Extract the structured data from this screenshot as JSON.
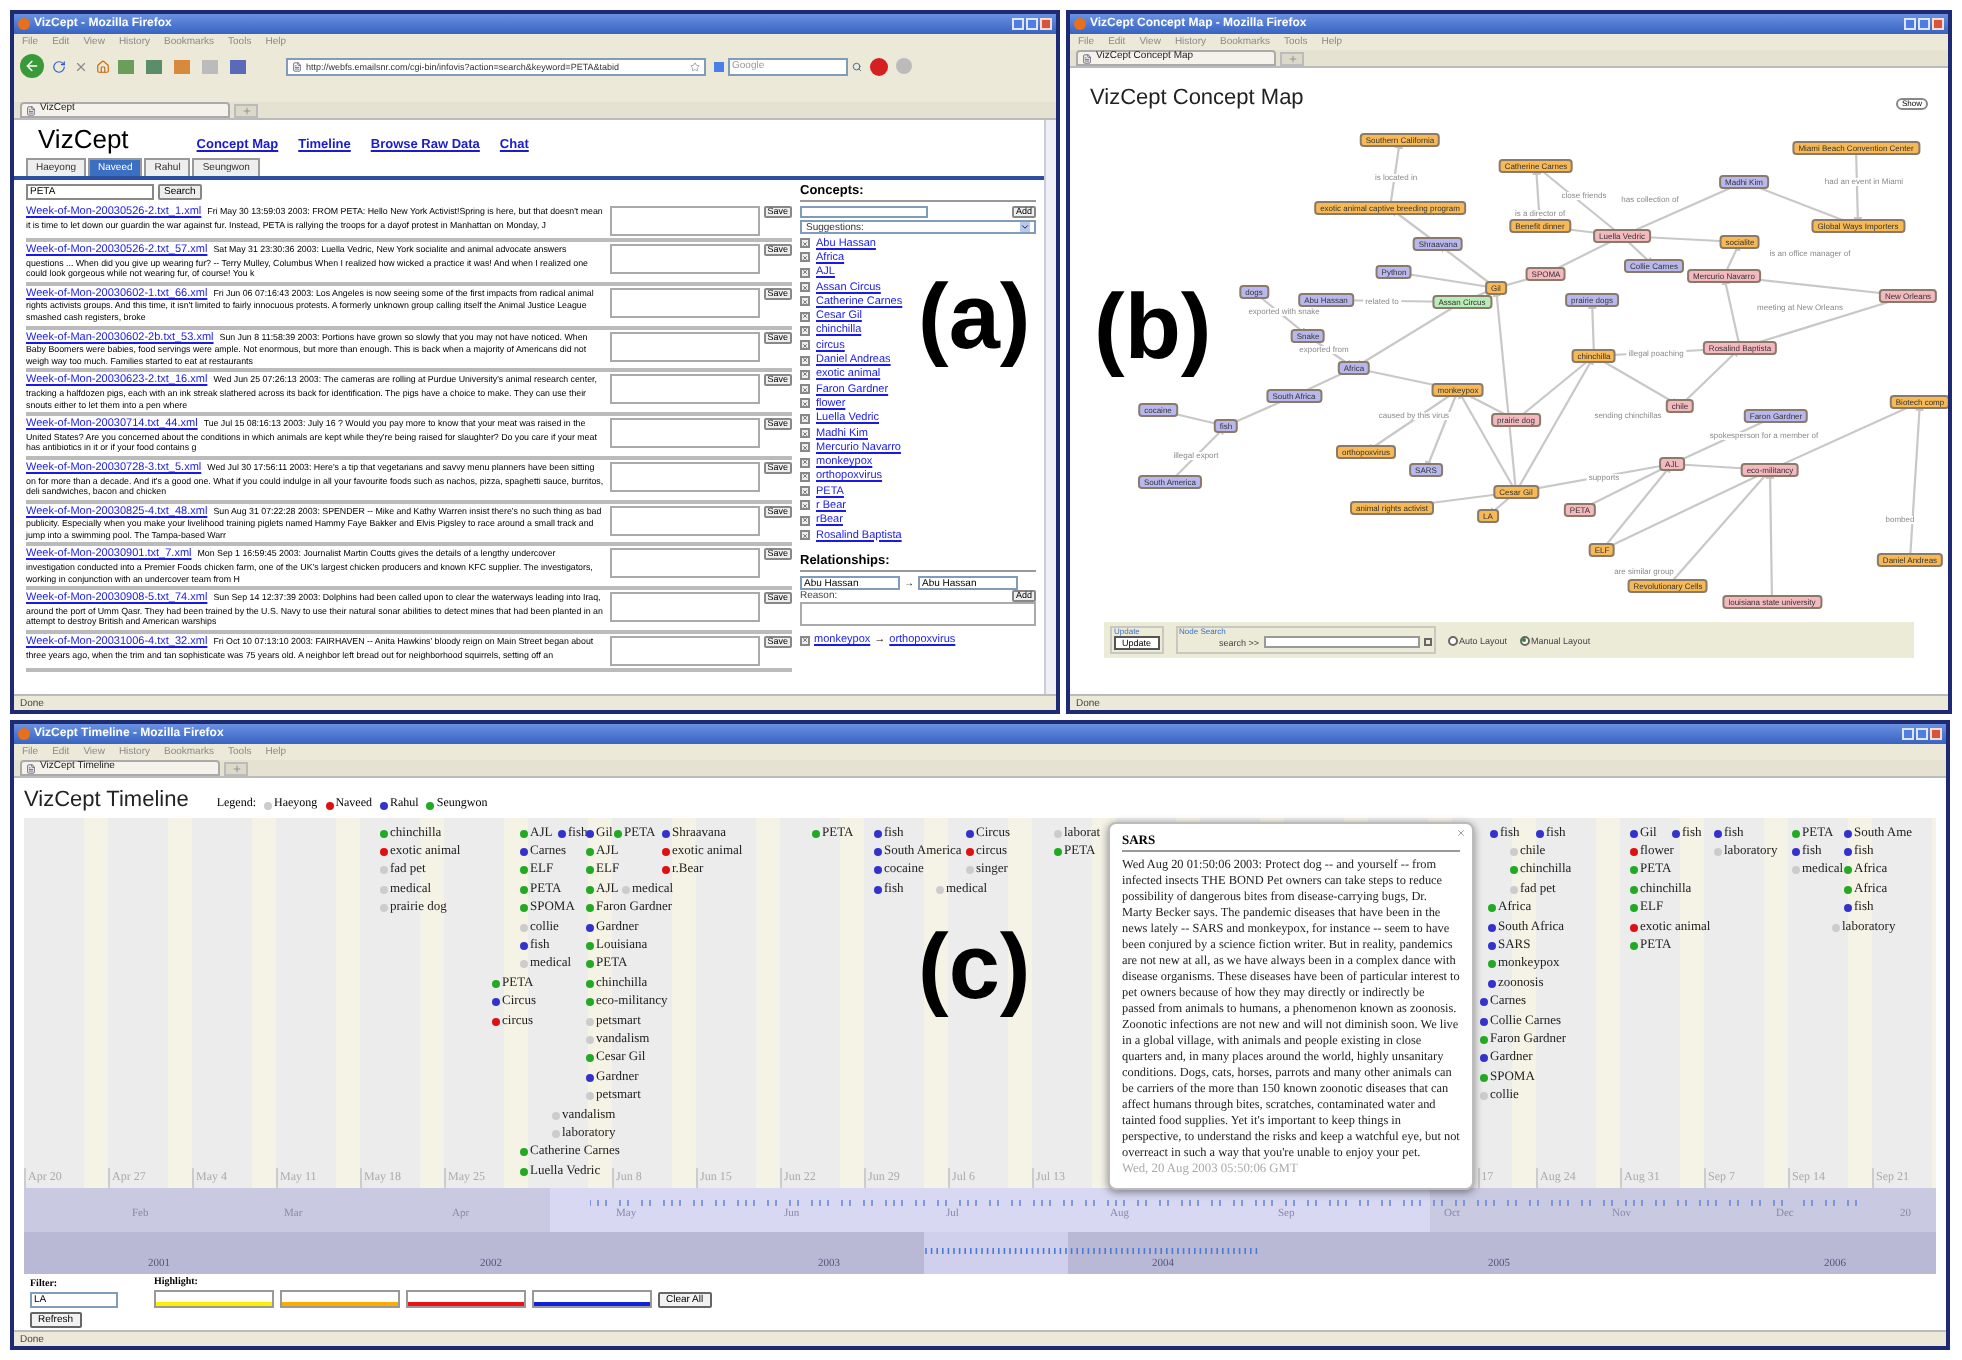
{
  "window_a": {
    "title": "VizCept - Mozilla Firefox",
    "menu": [
      "File",
      "Edit",
      "View",
      "History",
      "Bookmarks",
      "Tools",
      "Help"
    ],
    "url": "http://webfs.emailsnr.com/cgi-bin/infovis?action=search&keyword=PETA&tabid",
    "search_placeholder": "Google",
    "tab": "VizCept",
    "app_title": "VizCept",
    "nav_links": [
      "Concept Map",
      "Timeline",
      "Browse Raw Data",
      "Chat"
    ],
    "user_tabs": [
      {
        "label": "Haeyong",
        "selected": false
      },
      {
        "label": "Naveed",
        "selected": true
      },
      {
        "label": "Rahul",
        "selected": false
      },
      {
        "label": "Seungwon",
        "selected": false
      }
    ],
    "search": {
      "value": "PETA",
      "button": "Search"
    },
    "results": [
      {
        "link": "Week-of-Mon-20030526-2.txt_1.xml",
        "text": "Fri May 30 13:59:03 2003: FROM PETA: Hello New York Activist!Spring is here, but that doesn't mean it is time to let down our guardin the war against fur. Instead, PETA is rallying the troops for a dayof protest in Manhattan on Monday, J",
        "button": "Save"
      },
      {
        "link": "Week-of-Mon-20030526-2.txt_57.xml",
        "text": "Sat May 31 23:30:36 2003: Luella Vedric, New York socialite and animal advocate answers questions ... When did you give up wearing fur? -- Terry Mulley, Columbus When I realized how wicked a practice it was! And when I realized one could look gorgeous while not wearing fur, of course! You k",
        "button": "Save"
      },
      {
        "link": "Week-of-Mon-20030602-1.txt_66.xml",
        "text": "Fri Jun 06 07:16:43 2003: Los Angeles is now seeing some of the first impacts from radical animal rights activists groups. And this time, it isn't limited to fairly innocuous protests. A formerly unknown group calling itself the Animal Justice League smashed cash registers, broke",
        "button": "Save"
      },
      {
        "link": "Week-of-Man-20030602-2b.txt_53.xml",
        "text": "Sun Jun 8 11:58:39 2003: Portions have grown so slowly that you may not have noticed. When Baby Boomers were babies, food servings were ample. Not enormous, but more than enough. This is back when a majority of Americans did not weigh way too much. Families started to eat at restaurants",
        "button": "Save"
      },
      {
        "link": "Week-of-Mon-20030623-2.txt_16.xml",
        "text": "Wed Jun 25 07:26:13 2003: The cameras are rolling at Purdue University's animal research center, tracking a halfdozen pigs, each with an ink streak slathered across its back for identification. The pigs have a choice to make. They can use their snouts either to let them into a pen where",
        "button": "Save"
      },
      {
        "link": "Week-of-Mon-20030714.txt_44.xml",
        "text": "Tue Jul 15 08:16:13 2003: July 16 ? Would you pay more to know that your meat was raised in the United States? Are you concerned about the conditions in which animals are kept while they're being raised for slaughter? Do you care if your meat has antibiotics in it or if your food contains g",
        "button": "Save"
      },
      {
        "link": "Week-of-Mon-20030728-3.txt_5.xml",
        "text": "Wed Jul 30 17:56:11 2003: Here's a tip that vegetarians and savvy menu planners have been sitting on for more than a decade. And it's a good one. What if you could indulge in all your favourite foods such as nachos, pizza, spaghetti sauce, burritos, deli sandwiches, bacon and chicken",
        "button": "Save"
      },
      {
        "link": "Week-of-Mon-20030825-4.txt_48.xml",
        "text": "Sun Aug 31 07:22:28 2003: SPENDER -- Mike and Kathy Warren insist there's no such thing as bad publicity. Especially when you make your livelihood training piglets named Hammy Faye Bakker and Elvis Pigsley to race around a small track and jump into a swimming pool. The Tampa-based Warr",
        "button": "Save"
      },
      {
        "link": "Week-of-Mon-20030901.txt_7.xml",
        "text": "Mon Sep 1 16:59:45 2003: Journalist Martin Coutts gives the details of a lengthy undercover investigation conducted into a Premier Foods chicken farm, one of the UK's largest chicken producers and known KFC supplier. The investigators, working in conjunction with an undercover team from H",
        "button": "Save"
      },
      {
        "link": "Week-of-Mon-20030908-5.txt_74.xml",
        "text": "Sun Sep 14 12:37:39 2003: Dolphins had been called upon to clear the waterways leading into Iraq, around the port of Umm Qasr. They had been trained by the U.S. Navy to use their natural sonar abilities to detect mines that had been planted in an attempt to destroy British and American warships",
        "button": "Save"
      },
      {
        "link": "Week-of-Mon-20031006-4.txt_32.xml",
        "text": "Fri Oct 10 07:13:10 2003: FAIRHAVEN -- Anita Hawkins' bloody reign on Main Street began about three years ago, when the trim and tan sophisticate was 75 years old. A neighbor left bread out for neighborhood squirrels, setting off an",
        "button": "Save"
      }
    ],
    "concepts": {
      "heading": "Concepts:",
      "add_button": "Add",
      "suggestions": "Suggestions:",
      "items": [
        "Abu Hassan",
        "Africa",
        "AJL",
        "Assan Circus",
        "Catherine Carnes",
        "Cesar Gil",
        "chinchilla",
        "circus",
        "Daniel Andreas",
        "exotic animal",
        "Faron Gardner",
        "flower",
        "Luella Vedric",
        "Madhi Kim",
        "Mercurio Navarro",
        "monkeypox",
        "orthopoxvirus",
        "PETA",
        "r Bear",
        "rBear",
        "Rosalind Baptista"
      ]
    },
    "relationships": {
      "heading": "Relationships:",
      "from": "Abu Hassan",
      "arrow": "→",
      "to": "Abu Hassan",
      "reason_label": "Reason:",
      "add_button": "Add",
      "items": [
        {
          "from": "monkeypox",
          "arrow": "→",
          "to": "orthopoxvirus"
        }
      ]
    },
    "status": "Done",
    "panel_label": "(a)"
  },
  "window_b": {
    "title": "VizCept Concept Map - Mozilla Firefox",
    "menu": [
      "File",
      "Edit",
      "View",
      "History",
      "Bookmarks",
      "Tools",
      "Help"
    ],
    "tab": "VizCept Concept Map",
    "heading": "VizCept Concept Map",
    "show_button": "Show",
    "nodes": [
      {
        "label": "Southern California",
        "color": "#f7b955"
      },
      {
        "label": "exotic animal captive breeding program",
        "color": "#f7b955"
      },
      {
        "label": "Catherine Carnes",
        "color": "#f7b955"
      },
      {
        "label": "Miami Beach Convention Center",
        "color": "#f7b955"
      },
      {
        "label": "Madhi Kim",
        "color": "#b8b8ee"
      },
      {
        "label": "Benefit dinner",
        "color": "#f7b955"
      },
      {
        "label": "Global Ways Importers",
        "color": "#f7b955"
      },
      {
        "label": "Luella Vedric",
        "color": "#f4b8bf"
      },
      {
        "label": "socialite",
        "color": "#f7b955"
      },
      {
        "label": "Collie Carnes",
        "color": "#b8b8ee"
      },
      {
        "label": "Shraavana",
        "color": "#b8b8ee"
      },
      {
        "label": "Python",
        "color": "#b8b8ee"
      },
      {
        "label": "SPOMA",
        "color": "#f4b8bf"
      },
      {
        "label": "Mercurio Navarro",
        "color": "#f4b8bf"
      },
      {
        "label": "Gil",
        "color": "#f7b955"
      },
      {
        "label": "New Orleans",
        "color": "#f4b8bf"
      },
      {
        "label": "dogs",
        "color": "#b8b8ee"
      },
      {
        "label": "Abu Hassan",
        "color": "#b8b8ee"
      },
      {
        "label": "Assan Circus",
        "color": "#b8ecb8"
      },
      {
        "label": "prairie dogs",
        "color": "#b8b8ee"
      },
      {
        "label": "Snake",
        "color": "#b8b8ee"
      },
      {
        "label": "Rosalind Baptista",
        "color": "#f4b8bf"
      },
      {
        "label": "chinchilla",
        "color": "#f7b955"
      },
      {
        "label": "Africa",
        "color": "#b8b8ee"
      },
      {
        "label": "monkeypox",
        "color": "#f7b955"
      },
      {
        "label": "South Africa",
        "color": "#b8b8ee"
      },
      {
        "label": "chile",
        "color": "#f4b8bf"
      },
      {
        "label": "Biotech comp",
        "color": "#f7b955"
      },
      {
        "label": "cocaine",
        "color": "#b8b8ee"
      },
      {
        "label": "fish",
        "color": "#b8b8ee"
      },
      {
        "label": "prairie dog",
        "color": "#f4b8bf"
      },
      {
        "label": "Faron Gardner",
        "color": "#b8b8ee"
      },
      {
        "label": "orthopoxvirus",
        "color": "#f7b955"
      },
      {
        "label": "SARS",
        "color": "#b8b8ee"
      },
      {
        "label": "AJL",
        "color": "#f4b8bf"
      },
      {
        "label": "eco-militancy",
        "color": "#f4b8bf"
      },
      {
        "label": "South America",
        "color": "#b8b8ee"
      },
      {
        "label": "Cesar Gil",
        "color": "#f7b955"
      },
      {
        "label": "animal rights activist",
        "color": "#f7b955"
      },
      {
        "label": "PETA",
        "color": "#f4b8bf"
      },
      {
        "label": "LA",
        "color": "#f7b955"
      },
      {
        "label": "ELF",
        "color": "#f7b955"
      },
      {
        "label": "Revolutionary Cells",
        "color": "#f7b955"
      },
      {
        "label": "louisiana state university",
        "color": "#f4b8bf"
      },
      {
        "label": "Daniel Andreas",
        "color": "#f7b955"
      }
    ],
    "edge_labels": [
      "is located in",
      "close friends",
      "has collection of",
      "had an event in Miami",
      "is an office manager of",
      "is a director of",
      "related to",
      "exported with snake",
      "exported from",
      "illegal export",
      "meeting at New Orleans",
      "illegal poaching",
      "sending chinchillas",
      "spokesperson for a member of",
      "caused by this virus",
      "supports",
      "are similar group",
      "bombed"
    ],
    "update_legend": "Update",
    "update_button": "Update",
    "search_legend": "Node Search",
    "search_label": "search >>",
    "layouts": [
      {
        "label": "Auto Layout",
        "selected": false
      },
      {
        "label": "Manual Layout",
        "selected": true
      }
    ],
    "status": "Done",
    "panel_label": "(b)"
  },
  "window_c": {
    "title": "VizCept Timeline - Mozilla Firefox",
    "menu": [
      "File",
      "Edit",
      "View",
      "History",
      "Bookmarks",
      "Tools",
      "Help"
    ],
    "tab": "VizCept Timeline",
    "heading": "VizCept Timeline",
    "legend": {
      "label": "Legend:",
      "users": [
        {
          "name": "Haeyong",
          "color": "#cccccc"
        },
        {
          "name": "Naveed",
          "color": "#dd1111"
        },
        {
          "name": "Rahul",
          "color": "#3333cc"
        },
        {
          "name": "Seungwon",
          "color": "#22aa22"
        }
      ]
    },
    "columns": [
      {
        "items": [
          {
            "label": "chinchilla",
            "color": "#22aa22"
          },
          {
            "label": "exotic animal",
            "color": "#dd1111"
          },
          {
            "label": "fad pet",
            "color": "#cccccc"
          },
          {
            "label": "medical",
            "color": "#cccccc"
          },
          {
            "label": "prairie dog",
            "color": "#cccccc"
          }
        ]
      },
      {
        "items": [
          {
            "label": "AJL",
            "color": "#22aa22"
          },
          {
            "label": "Carnes",
            "color": "#3333cc"
          },
          {
            "label": "ELF",
            "color": "#22aa22"
          },
          {
            "label": "PETA",
            "color": "#22aa22"
          },
          {
            "label": "SPOMA",
            "color": "#22aa22"
          },
          {
            "label": "collie",
            "color": "#cccccc"
          },
          {
            "label": "fish",
            "color": "#3333cc"
          },
          {
            "label": "medical",
            "color": "#cccccc"
          }
        ]
      },
      {
        "items": [
          {
            "label": "PETA",
            "color": "#22aa22"
          },
          {
            "label": "Circus",
            "color": "#3333cc"
          },
          {
            "label": "circus",
            "color": "#dd1111"
          }
        ]
      },
      {
        "items": [
          {
            "label": "fish",
            "color": "#3333cc"
          }
        ]
      },
      {
        "items": [
          {
            "label": "Gil",
            "color": "#3333cc"
          },
          {
            "label": "AJL",
            "color": "#22aa22"
          },
          {
            "label": "ELF",
            "color": "#22aa22"
          },
          {
            "label": "AJL",
            "color": "#22aa22"
          },
          {
            "label": "Faron Gardner",
            "color": "#22aa22"
          },
          {
            "label": "Gardner",
            "color": "#3333cc"
          },
          {
            "label": "Louisiana",
            "color": "#22aa22"
          },
          {
            "label": "PETA",
            "color": "#22aa22"
          },
          {
            "label": "chinchilla",
            "color": "#22aa22"
          },
          {
            "label": "eco-militancy",
            "color": "#22aa22"
          },
          {
            "label": "petsmart",
            "color": "#cccccc"
          },
          {
            "label": "vandalism",
            "color": "#cccccc"
          },
          {
            "label": "Cesar Gil",
            "color": "#22aa22"
          },
          {
            "label": "Gardner",
            "color": "#3333cc"
          },
          {
            "label": "petsmart",
            "color": "#cccccc"
          }
        ]
      },
      {
        "items": [
          {
            "label": "PETA",
            "color": "#22aa22"
          }
        ]
      },
      {
        "items": [
          {
            "label": "medical",
            "color": "#cccccc"
          }
        ]
      },
      {
        "items": [
          {
            "label": "vandalism",
            "color": "#cccccc"
          },
          {
            "label": "laboratory",
            "color": "#cccccc"
          }
        ]
      },
      {
        "items": [
          {
            "label": "Catherine Carnes",
            "color": "#22aa22"
          },
          {
            "label": "Luella Vedric",
            "color": "#22aa22"
          }
        ]
      },
      {
        "items": [
          {
            "label": "Shraavana",
            "color": "#3333cc"
          },
          {
            "label": "exotic animal",
            "color": "#dd1111"
          },
          {
            "label": "r.Bear",
            "color": "#dd1111"
          }
        ]
      },
      {
        "items": [
          {
            "label": "PETA",
            "color": "#22aa22"
          }
        ]
      },
      {
        "items": [
          {
            "label": "fish",
            "color": "#3333cc"
          },
          {
            "label": "South America",
            "color": "#3333cc"
          },
          {
            "label": "cocaine",
            "color": "#3333cc"
          },
          {
            "label": "fish",
            "color": "#3333cc"
          }
        ]
      },
      {
        "items": [
          {
            "label": "Circus",
            "color": "#3333cc"
          },
          {
            "label": "circus",
            "color": "#dd1111"
          },
          {
            "label": "singer",
            "color": "#cccccc"
          }
        ]
      },
      {
        "items": [
          {
            "label": "medical",
            "color": "#cccccc"
          }
        ]
      },
      {
        "items": [
          {
            "label": "laborat",
            "color": "#cccccc"
          },
          {
            "label": "PETA",
            "color": "#22aa22"
          }
        ]
      },
      {
        "items": [
          {
            "label": "fish",
            "color": "#3333cc"
          }
        ]
      },
      {
        "items": [
          {
            "label": "fish",
            "color": "#3333cc"
          }
        ]
      },
      {
        "items": [
          {
            "label": "chile",
            "color": "#cccccc"
          },
          {
            "label": "chinchilla",
            "color": "#22aa22"
          },
          {
            "label": "fad pet",
            "color": "#cccccc"
          }
        ]
      },
      {
        "items": [
          {
            "label": "Africa",
            "color": "#22aa22"
          },
          {
            "label": "South Africa",
            "color": "#3333cc"
          },
          {
            "label": "SARS",
            "color": "#3333cc"
          },
          {
            "label": "monkeypox",
            "color": "#22aa22"
          },
          {
            "label": "zoonosis",
            "color": "#3333cc"
          }
        ]
      },
      {
        "items": [
          {
            "label": "Carnes",
            "color": "#3333cc"
          },
          {
            "label": "Collie Carnes",
            "color": "#3333cc"
          },
          {
            "label": "Faron Gardner",
            "color": "#22aa22"
          },
          {
            "label": "Gardner",
            "color": "#3333cc"
          },
          {
            "label": "SPOMA",
            "color": "#22aa22"
          },
          {
            "label": "collie",
            "color": "#cccccc"
          }
        ]
      },
      {
        "items": [
          {
            "label": "Gil",
            "color": "#3333cc"
          },
          {
            "label": "flower",
            "color": "#dd1111"
          },
          {
            "label": "PETA",
            "color": "#22aa22"
          },
          {
            "label": "chinchilla",
            "color": "#22aa22"
          },
          {
            "label": "ELF",
            "color": "#22aa22"
          },
          {
            "label": "exotic animal",
            "color": "#dd1111"
          },
          {
            "label": "PETA",
            "color": "#22aa22"
          }
        ]
      },
      {
        "items": [
          {
            "label": "fish",
            "color": "#3333cc"
          }
        ]
      },
      {
        "items": [
          {
            "label": "fish",
            "color": "#3333cc"
          },
          {
            "label": "laboratory",
            "color": "#cccccc"
          }
        ]
      },
      {
        "items": [
          {
            "label": "PETA",
            "color": "#22aa22"
          },
          {
            "label": "fish",
            "color": "#3333cc"
          },
          {
            "label": "medical",
            "color": "#cccccc"
          }
        ]
      },
      {
        "items": [
          {
            "label": "South Ame",
            "color": "#3333cc"
          },
          {
            "label": "fish",
            "color": "#3333cc"
          },
          {
            "label": "Africa",
            "color": "#22aa22"
          },
          {
            "label": "Africa",
            "color": "#22aa22"
          },
          {
            "label": "fish",
            "color": "#3333cc"
          }
        ]
      },
      {
        "items": [
          {
            "label": "laboratory",
            "color": "#cccccc"
          }
        ]
      }
    ],
    "ticks": [
      "Apr 20",
      "Apr 27",
      "May 4",
      "May 11",
      "May 18",
      "May 25",
      "Jun 8",
      "Jun 15",
      "Jun 22",
      "Jun 29",
      "Jul 6",
      "Jul 13",
      "17",
      "Aug 24",
      "Aug 31",
      "Sep 7",
      "Sep 14",
      "Sep 21"
    ],
    "months": [
      "Feb",
      "Mar",
      "Apr",
      "May",
      "Jun",
      "Jul",
      "Aug",
      "Sep",
      "Oct",
      "Nov",
      "Dec",
      "20"
    ],
    "years": [
      "2001",
      "2002",
      "2003",
      "2004",
      "2005",
      "2006"
    ],
    "popup": {
      "title": "SARS",
      "body": "Wed Aug 20 01:50:06 2003: Protect dog -- and yourself -- from infected insects THE BOND Pet owners can take steps to reduce possibility of dangerous bites from disease-carrying bugs, Dr. Marty Becker says. The pandemic diseases that have been in the news lately -- SARS and monkeypox, for instance -- seem to have been conjured by a science fiction writer. But in reality, pandemics are not new at all, as we have always been in a complex dance with disease organisms. These diseases have been of particular interest to pet owners because of how they may directly or indirectly be passed from animals to humans, a phenomenon known as zoonosis. Zoonotic infections are not new and will not diminish soon. We live in a global village, with animals and people existing in close quarters and, in many places around the world, highly unsanitary conditions. Dogs, cats, horses, parrots and many other animals can be carriers of the more than 150 known zoonotic diseases that can affect humans through bites, scratches, contaminated water and tainted food supplies. Yet it's important to keep things in perspective, to understand the risks and keep a watchful eye, but not overreact in such a way that you're unable to enjoy your pet.",
      "date": "Wed, 20 Aug 2003 05:50:06 GMT"
    },
    "filter": {
      "label": "Filter:",
      "value": "LA"
    },
    "highlight": {
      "label": "Highlight:",
      "fields": [
        {
          "color": "#ffee00"
        },
        {
          "color": "#ffaa00"
        },
        {
          "color": "#ee1111"
        },
        {
          "color": "#1122dd"
        }
      ]
    },
    "clear_button": "Clear All",
    "refresh_button": "Refresh",
    "status": "Done",
    "panel_label": "(c)"
  }
}
